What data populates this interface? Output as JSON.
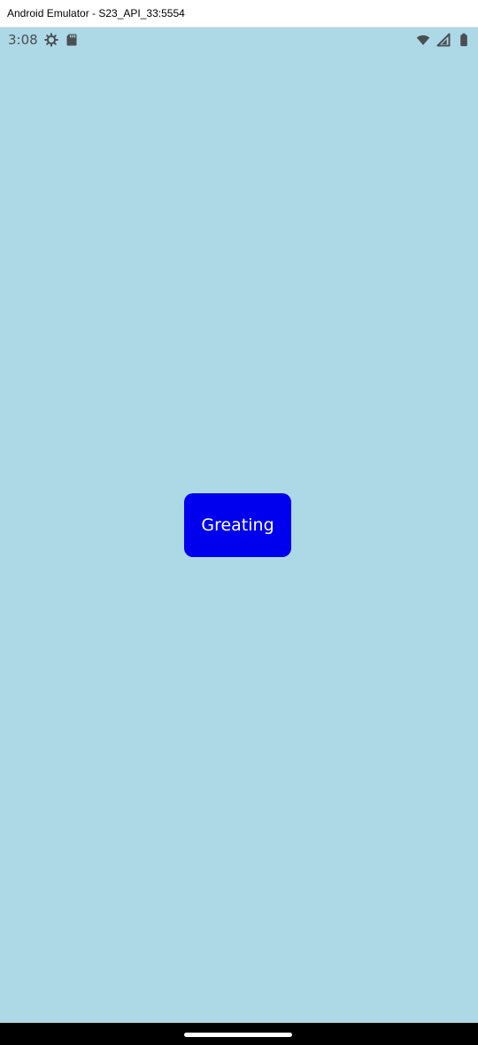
{
  "window": {
    "title": "Android Emulator - S23_API_33:5554"
  },
  "status_bar": {
    "time": "3:08",
    "left_icons": [
      "settings-icon",
      "sd-card-icon"
    ],
    "right_icons": [
      "wifi-icon",
      "signal-icon",
      "battery-icon"
    ],
    "icon_color": "#4a4f53"
  },
  "screen": {
    "background_color": "#add8e6",
    "button": {
      "label": "Greating",
      "background_color": "#0000ee",
      "text_color": "#ffffff"
    }
  },
  "navigation": {
    "gesture_handle": "home-handle"
  }
}
